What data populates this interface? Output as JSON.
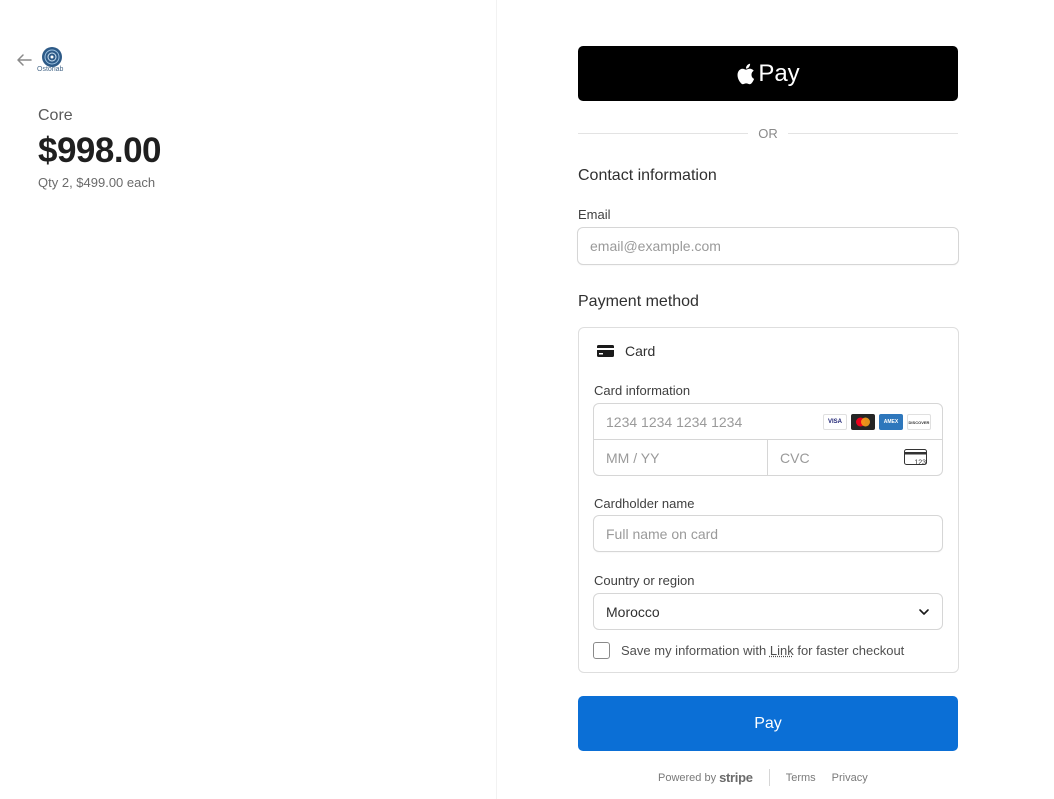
{
  "summary": {
    "logo_text": "Ostorlab",
    "product_name": "Core",
    "price": "$998.00",
    "qty_text": "Qty 2, $499.00 each"
  },
  "checkout": {
    "apple_pay_label": "Pay",
    "or_text": "OR",
    "contact_title": "Contact information",
    "email_label": "Email",
    "email_placeholder": "email@example.com",
    "payment_title": "Payment method",
    "card_tab_label": "Card",
    "card_info_label": "Card information",
    "card_number_placeholder": "1234 1234 1234 1234",
    "expiry_placeholder": "MM / YY",
    "cvc_placeholder": "CVC",
    "cardholder_label": "Cardholder name",
    "cardholder_placeholder": "Full name on card",
    "country_label": "Country or region",
    "country_value": "Morocco",
    "save_info_prefix": "Save my information with",
    "save_info_link": "Link",
    "save_info_suffix": "for faster checkout",
    "pay_button": "Pay",
    "cvc_icon_text": "123"
  },
  "brands": {
    "visa": "VISA",
    "amex": "AMEX",
    "discover": "DISCOVER"
  },
  "footer": {
    "powered_by": "Powered by",
    "stripe": "stripe",
    "terms": "Terms",
    "privacy": "Privacy"
  },
  "colors": {
    "pay_button": "#0b6fd6",
    "apple_pay": "#000000"
  }
}
